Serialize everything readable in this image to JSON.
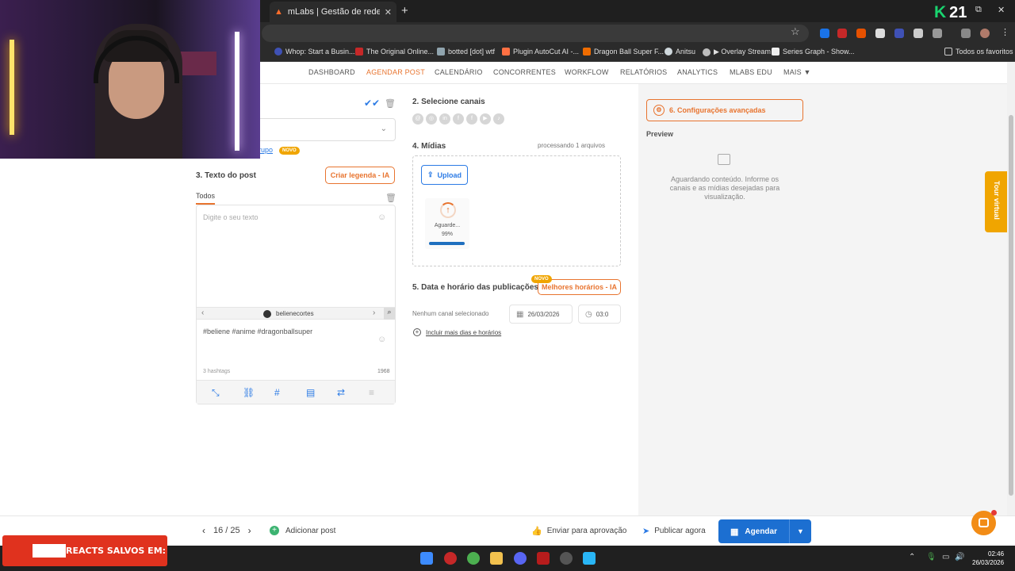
{
  "browser": {
    "tab_title": "mLabs | Gestão de redes sociais",
    "tab_close": "✕",
    "new_tab": "+",
    "bookmarks": [
      "Whop: Start a Busin...",
      "The Original Online...",
      "botted [dot] wtf",
      "Plugin AutoCut AI -...",
      "Dragon Ball Super F...",
      "Anitsu",
      "▶ Overlay Stream",
      "Series Graph - Show..."
    ],
    "bookmarks_all": "Todos os favoritos",
    "kick_count": "21"
  },
  "nav": {
    "items": [
      "DASHBOARD",
      "AGENDAR POST",
      "CALENDÁRIO",
      "CONCORRENTES",
      "WORKFLOW",
      "RELATÓRIOS",
      "ANALYTICS",
      "MLABS EDU",
      "MAIS ▼"
    ],
    "active": "AGENDAR POST"
  },
  "left": {
    "grupo_link": "rupo",
    "novo_badge": "NOVO",
    "section3_title": "3. Texto do post",
    "ai_caption_btn": "Criar legenda - IA",
    "tab_all": "Todos",
    "placeholder": "Digite o seu texto",
    "account_name": "belienecortes",
    "hashtags_text": "#beliene #anime #dragonballsuper",
    "hashtags_count": "3 hashtags",
    "char_count": "1968"
  },
  "middle": {
    "section2_title": "2. Selecione canais",
    "section4_title": "4. Mídias",
    "processing": "processando 1 arquivos",
    "upload_btn": "Upload",
    "media_label": "Aguarde...",
    "media_pct": "99%",
    "media_progress": 0.99,
    "section5_title": "5. Data e horário das publicações",
    "best_times_btn": "Melhores horários - IA",
    "novo_badge": "NOVO",
    "no_channel": "Nenhum canal selecionado",
    "date": "26/03/2026",
    "time": "03:0",
    "more_dates": "Incluir mais dias e horários"
  },
  "right": {
    "advanced_btn": "6. Configurações avançadas",
    "preview_title": "Preview",
    "preview_msg": "Aguardando conteúdo. Informe os canais e as mídias desejadas para visualização.",
    "tour": "Tour virtual"
  },
  "footer": {
    "pager": "16 / 25",
    "add_post": "Adicionar post",
    "approval": "Enviar para aprovação",
    "publish_now": "Publicar agora",
    "schedule": "Agendar"
  },
  "taskbar": {
    "time": "02:46",
    "date": "26/03/2026"
  },
  "overlay": {
    "reacts_label": "REACTS SALVOS EM:"
  },
  "colors": {
    "accent_orange": "#e8742f",
    "primary_blue": "#1c6fd1",
    "badge_yellow": "#f0a500"
  }
}
